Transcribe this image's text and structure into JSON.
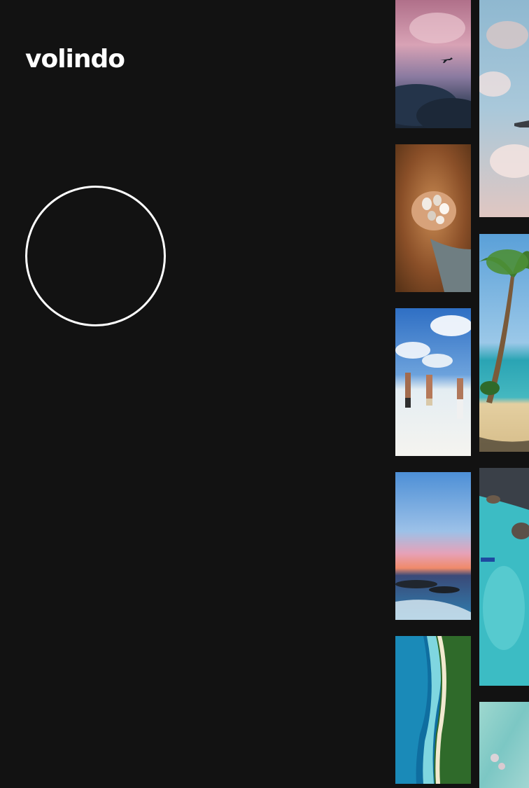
{
  "brand": {
    "logo_text": "volindo"
  },
  "loader": {
    "icon": "loading-circle"
  },
  "gallery": {
    "column_a": [
      {
        "icon": "airplane-sky-photo"
      },
      {
        "icon": "seashells-hand-photo"
      },
      {
        "icon": "people-jumping-beach-photo"
      },
      {
        "icon": "sunset-ocean-photo"
      },
      {
        "icon": "aerial-coast-photo"
      }
    ],
    "column_b": [
      {
        "icon": "airplane-clouds-photo"
      },
      {
        "icon": "palm-beach-photo"
      },
      {
        "icon": "aerial-reef-photo"
      },
      {
        "icon": "blurred-teal-photo"
      }
    ]
  },
  "colors": {
    "background": "#121212",
    "foreground": "#ffffff"
  }
}
